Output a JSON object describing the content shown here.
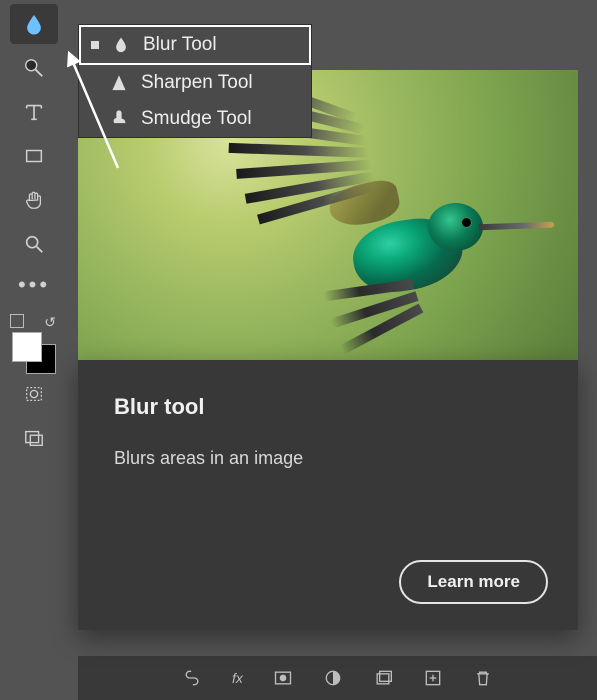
{
  "toolbar": {
    "tools": {
      "blur": "blur-icon",
      "lasso": "lasso-icon",
      "type": "type-icon",
      "rect": "rectangle-icon",
      "hand": "hand-icon",
      "zoom": "zoom-icon",
      "quickmask": "quickmask-icon",
      "screenmode": "screenmode-icon"
    }
  },
  "flyout": {
    "items": [
      {
        "label": "Blur Tool",
        "icon": "drop-icon",
        "selected": true
      },
      {
        "label": "Sharpen Tool",
        "icon": "triangle-icon",
        "selected": false
      },
      {
        "label": "Smudge Tool",
        "icon": "finger-icon",
        "selected": false
      }
    ]
  },
  "tooltip": {
    "title": "Blur tool",
    "description": "Blurs areas in an image",
    "learn_label": "Learn more"
  },
  "statusbar": {
    "items": [
      "link-icon",
      "fx-label",
      "mask-icon",
      "adjust-icon",
      "group-icon",
      "newlayer-icon",
      "trash-icon"
    ],
    "fx_text": "fx"
  },
  "swatch": {
    "fg": "#ffffff",
    "bg": "#000000"
  }
}
